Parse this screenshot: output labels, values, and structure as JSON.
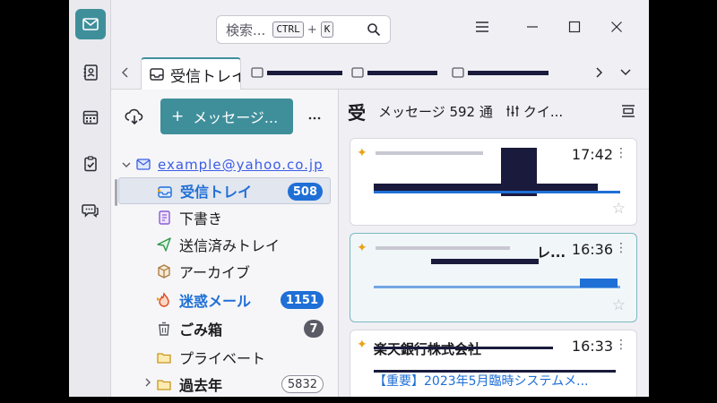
{
  "search": {
    "placeholder": "検索...",
    "key1": "CTRL",
    "plus": "+",
    "key2": "K"
  },
  "tabs": {
    "active_label": "受信トレイ"
  },
  "write_button": {
    "label": "メッセージ..."
  },
  "account": {
    "name": "example@yahoo.co.jp"
  },
  "folders": [
    {
      "name": "受信トレイ",
      "count": "508"
    },
    {
      "name": "下書き"
    },
    {
      "name": "送信済みトレイ"
    },
    {
      "name": "アーカイブ"
    },
    {
      "name": "迷惑メール",
      "count": "1151"
    },
    {
      "name": "ごみ箱",
      "count": "7"
    },
    {
      "name": "プライベート"
    },
    {
      "name": "過去年",
      "count": "5832"
    }
  ],
  "list_header": {
    "folder_initial": "受",
    "count_text": "メッセージ 592 通",
    "quick_filter_label": "クイ..."
  },
  "messages": [
    {
      "time": "17:42"
    },
    {
      "time": "16:36",
      "sender_tail": "レ..."
    },
    {
      "time": "16:33",
      "sender": "楽天銀行株式会社",
      "subject": "【重要】2023年5月臨時システムメ..."
    }
  ],
  "colors": {
    "accent": "#3f8f9b",
    "link_blue": "#1f6fd6",
    "star": "#e8a317"
  }
}
